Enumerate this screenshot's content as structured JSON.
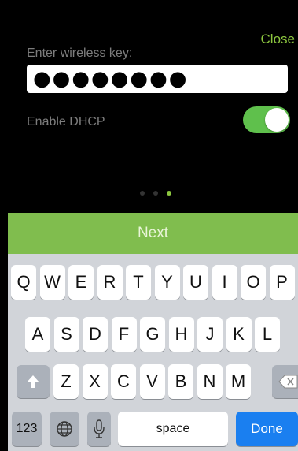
{
  "header": {
    "close_label": "Close"
  },
  "form": {
    "key_label": "Enter wireless key:",
    "key_value": "●●●●●●●●",
    "dhcp_label": "Enable DHCP",
    "dhcp_enabled": true
  },
  "pager": {
    "count": 3,
    "active_index": 2
  },
  "next_label": "Next",
  "keyboard": {
    "row1": [
      "Q",
      "W",
      "E",
      "R",
      "T",
      "Y",
      "U",
      "I",
      "O",
      "P"
    ],
    "row2": [
      "A",
      "S",
      "D",
      "F",
      "G",
      "H",
      "J",
      "K",
      "L"
    ],
    "row3": [
      "Z",
      "X",
      "C",
      "V",
      "B",
      "N",
      "M"
    ],
    "numbers_label": "123",
    "space_label": "space",
    "done_label": "Done",
    "icons": {
      "shift": "shift-arrow-icon",
      "delete": "backspace-icon",
      "globe": "globe-icon",
      "mic": "microphone-icon"
    }
  },
  "colors": {
    "accent": "#8cc63f",
    "next_bar": "#80bd4e",
    "toggle_on": "#5fc04c",
    "done_key": "#1a7ff0"
  }
}
